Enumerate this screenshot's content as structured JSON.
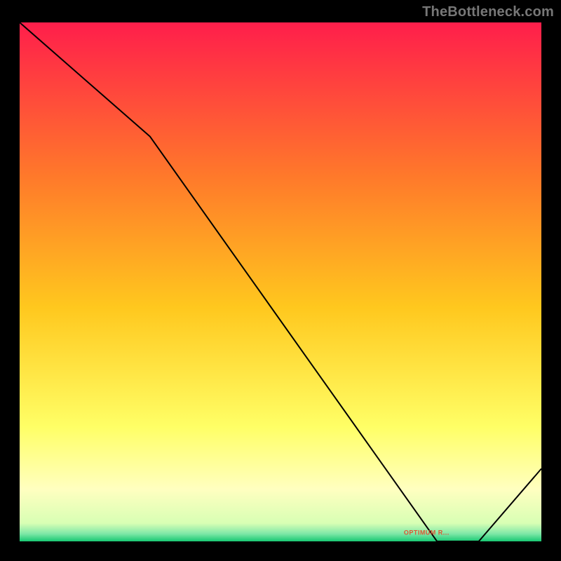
{
  "watermark": "TheBottleneck.com",
  "chart_data": {
    "type": "line",
    "title": "",
    "xlabel": "",
    "ylabel": "",
    "xlim": [
      0,
      100
    ],
    "ylim": [
      0,
      100
    ],
    "grid": false,
    "legend": false,
    "background_gradient_stops": [
      {
        "offset": 0.0,
        "color": "#ff1e4b"
      },
      {
        "offset": 0.3,
        "color": "#ff7a2a"
      },
      {
        "offset": 0.55,
        "color": "#ffc81e"
      },
      {
        "offset": 0.78,
        "color": "#ffff66"
      },
      {
        "offset": 0.9,
        "color": "#ffffc0"
      },
      {
        "offset": 0.965,
        "color": "#d8ffb4"
      },
      {
        "offset": 0.985,
        "color": "#80e8a8"
      },
      {
        "offset": 1.0,
        "color": "#18c873"
      }
    ],
    "series": [
      {
        "name": "curve",
        "color": "#000000",
        "x": [
          0,
          25,
          80,
          88,
          100
        ],
        "y": [
          100,
          78,
          0,
          0,
          14
        ]
      }
    ],
    "annotations": [
      {
        "text_key": "sweet_spot_label",
        "x": 78,
        "y": 1.3,
        "color": "#dd5533",
        "font_size": 9
      }
    ]
  },
  "labels": {
    "sweet_spot_label": "OPTIMUM R..."
  }
}
